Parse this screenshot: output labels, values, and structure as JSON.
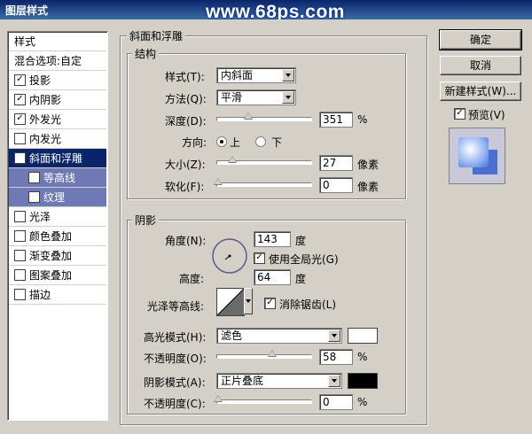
{
  "titlebar": {
    "title": "图层样式",
    "watermark": "www.68ps.com"
  },
  "sidebar": {
    "header": "样式",
    "blend": "混合选项:自定",
    "items": [
      {
        "label": "投影",
        "checked": "✓"
      },
      {
        "label": "内阴影",
        "checked": "✓"
      },
      {
        "label": "外发光",
        "checked": "✓"
      },
      {
        "label": "内发光",
        "checked": ""
      },
      {
        "label": "斜面和浮雕",
        "checked": "✓"
      },
      {
        "label": "等高线",
        "checked": "✓"
      },
      {
        "label": "纹理",
        "checked": ""
      },
      {
        "label": "光泽",
        "checked": ""
      },
      {
        "label": "颜色叠加",
        "checked": ""
      },
      {
        "label": "渐变叠加",
        "checked": ""
      },
      {
        "label": "图案叠加",
        "checked": ""
      },
      {
        "label": "描边",
        "checked": ""
      }
    ]
  },
  "bevel": {
    "title": "斜面和浮雕",
    "structure": {
      "title": "结构",
      "style_label": "样式(T):",
      "style_value": "内斜面",
      "technique_label": "方法(Q):",
      "technique_value": "平滑",
      "depth_label": "深度(D):",
      "depth_value": "351",
      "depth_unit": "%",
      "direction_label": "方向:",
      "dir_up": "上",
      "dir_down": "下",
      "size_label": "大小(Z):",
      "size_value": "27",
      "size_unit": "像素",
      "soften_label": "软化(F):",
      "soften_value": "0",
      "soften_unit": "像素"
    },
    "shading": {
      "title": "阴影",
      "angle_label": "角度(N):",
      "angle_value": "143",
      "angle_unit": "度",
      "global_light": "使用全局光(G)",
      "altitude_label": "高度:",
      "altitude_value": "64",
      "altitude_unit": "度",
      "gloss_label": "光泽等高线:",
      "antialias": "消除锯齿(L)",
      "highlight_label": "高光模式(H):",
      "highlight_value": "滤色",
      "highlight_color": "#ffffff",
      "hl_opacity_label": "不透明度(O):",
      "hl_opacity_value": "58",
      "hl_opacity_unit": "%",
      "shadow_label": "阴影模式(A):",
      "shadow_value": "正片叠底",
      "shadow_color": "#000000",
      "sh_opacity_label": "不透明度(C):",
      "sh_opacity_value": "0",
      "sh_opacity_unit": "%"
    }
  },
  "buttons": {
    "ok": "确定",
    "cancel": "取消",
    "new_style": "新建样式(W)...",
    "preview": "预览(V)"
  }
}
